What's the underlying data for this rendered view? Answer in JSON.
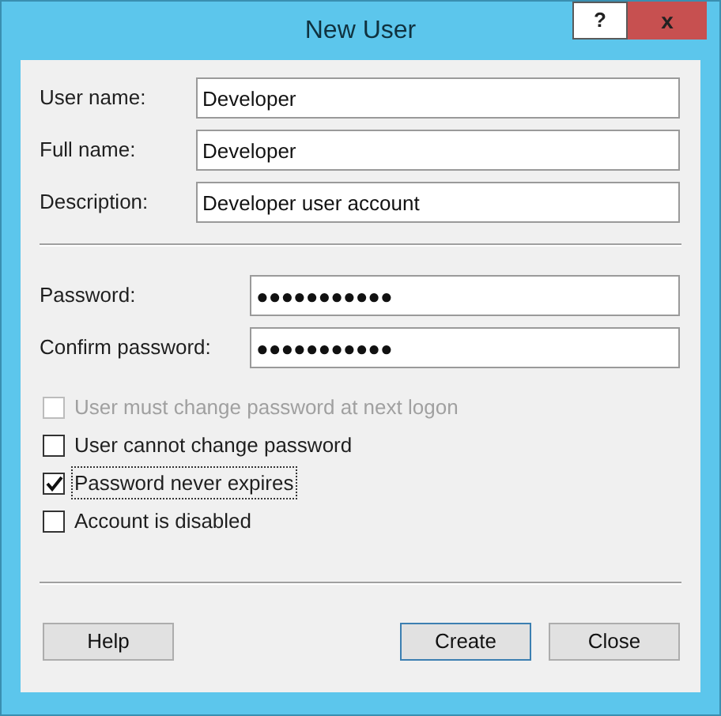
{
  "window": {
    "title": "New User",
    "help_button": "?",
    "close_button": "x"
  },
  "fields": [
    {
      "label": "User name:",
      "value": "Developer"
    },
    {
      "label": "Full name:",
      "value": "Developer"
    },
    {
      "label": "Description:",
      "value": "Developer user account"
    }
  ],
  "password_fields": [
    {
      "label": "Password:",
      "value": "●●●●●●●●●●●"
    },
    {
      "label": "Confirm password:",
      "value": "●●●●●●●●●●●"
    }
  ],
  "options": [
    {
      "label": "User must change password at next logon",
      "checked": false,
      "disabled": true,
      "focused": false
    },
    {
      "label": "User cannot change password",
      "checked": false,
      "disabled": false,
      "focused": false
    },
    {
      "label": "Password never expires",
      "checked": true,
      "disabled": false,
      "focused": true
    },
    {
      "label": "Account is disabled",
      "checked": false,
      "disabled": false,
      "focused": false
    }
  ],
  "buttons": [
    {
      "label": "Help",
      "default": false
    },
    {
      "label": "Create",
      "default": true
    },
    {
      "label": "Close",
      "default": false
    }
  ]
}
